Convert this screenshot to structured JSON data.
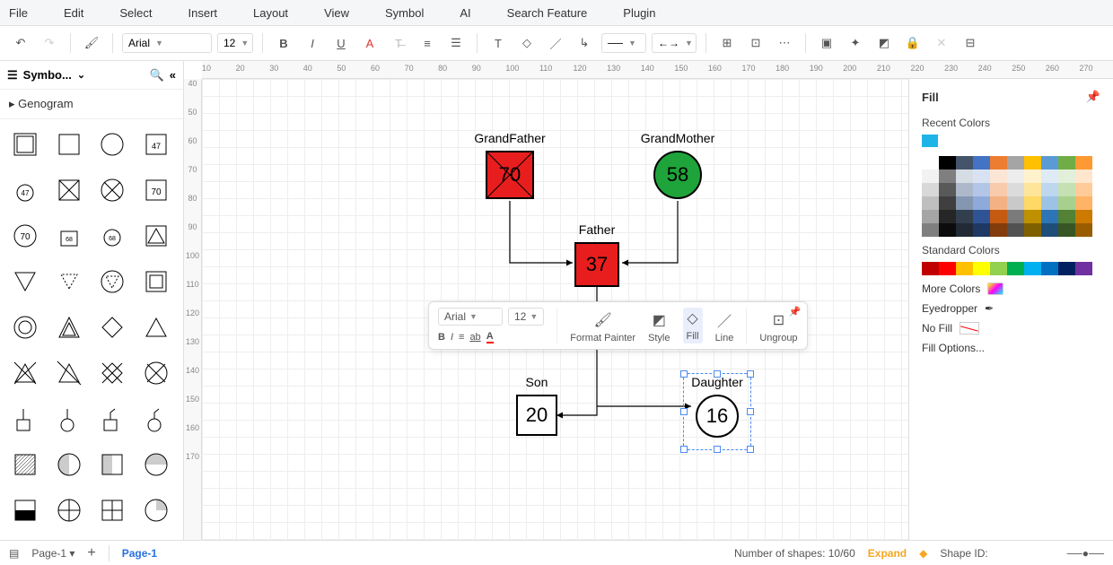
{
  "menu": [
    "File",
    "Edit",
    "Select",
    "Insert",
    "Layout",
    "View",
    "Symbol",
    "AI",
    "Search Feature",
    "Plugin"
  ],
  "font": {
    "family": "Arial",
    "size": "12"
  },
  "side": {
    "title": "Symbo...",
    "category": "Genogram"
  },
  "nodes": {
    "grandfather": {
      "label": "GrandFather",
      "value": "70"
    },
    "grandmother": {
      "label": "GrandMother",
      "value": "58"
    },
    "father": {
      "label": "Father",
      "value": "37"
    },
    "son": {
      "label": "Son",
      "value": "20"
    },
    "daughter": {
      "label": "Daughter",
      "value": "16"
    }
  },
  "mini": {
    "font": "Arial",
    "size": "12",
    "format_painter": "Format Painter",
    "style": "Style",
    "fill": "Fill",
    "line": "Line",
    "ungroup": "Ungroup"
  },
  "fill": {
    "title": "Fill",
    "recent": "Recent Colors",
    "recent_color": "#1fb4e8",
    "standard": "Standard Colors",
    "standard_colors": [
      "#c00000",
      "#ff0000",
      "#ffc000",
      "#ffff00",
      "#92d050",
      "#00b050",
      "#00b0f0",
      "#0070c0",
      "#002060",
      "#7030a0"
    ],
    "spectrum_head": [
      "#ffffff",
      "#000000",
      "#44546a",
      "#4472c4",
      "#ed7d31",
      "#a5a5a5",
      "#ffc000",
      "#5b9bd5",
      "#70ad47",
      "#ff9933"
    ],
    "spectrum_shades": [
      [
        "#f2f2f2",
        "#7f7f7f",
        "#d6dce4",
        "#d9e2f3",
        "#fbe5d5",
        "#ededed",
        "#fff2cc",
        "#deebf6",
        "#e2efd9",
        "#ffe6cc"
      ],
      [
        "#d8d8d8",
        "#595959",
        "#adb9ca",
        "#b4c6e7",
        "#f7cbac",
        "#dbdbdb",
        "#fee599",
        "#bdd7ee",
        "#c5e0b3",
        "#ffcc99"
      ],
      [
        "#bfbfbf",
        "#3f3f3f",
        "#8496b0",
        "#8eaadb",
        "#f4b183",
        "#c9c9c9",
        "#ffd965",
        "#9cc3e5",
        "#a8d08d",
        "#ffb366"
      ],
      [
        "#a5a5a5",
        "#262626",
        "#323f4f",
        "#2f5496",
        "#c55a11",
        "#7b7b7b",
        "#bf9000",
        "#2e75b5",
        "#538135",
        "#cc7a00"
      ],
      [
        "#7f7f7f",
        "#0c0c0c",
        "#222a35",
        "#1f3864",
        "#833c0b",
        "#525252",
        "#7f6000",
        "#1e4e79",
        "#375623",
        "#995c00"
      ]
    ],
    "more": "More Colors",
    "eyedropper": "Eyedropper",
    "nofill": "No Fill",
    "options": "Fill Options..."
  },
  "status": {
    "page_sel": "Page-1",
    "page_tab": "Page-1",
    "shapes": "Number of shapes: 10/60",
    "expand": "Expand",
    "shapeid": "Shape ID:"
  },
  "ruler_h": [
    "10",
    "20",
    "30",
    "40",
    "50",
    "60",
    "70",
    "80",
    "90",
    "100",
    "110",
    "120",
    "130",
    "140",
    "150",
    "160",
    "170",
    "180",
    "190",
    "200",
    "210",
    "220",
    "230",
    "240",
    "250",
    "260",
    "270"
  ],
  "ruler_v": [
    "40",
    "50",
    "60",
    "70",
    "80",
    "90",
    "100",
    "110",
    "120",
    "130",
    "140",
    "150",
    "160",
    "170"
  ]
}
